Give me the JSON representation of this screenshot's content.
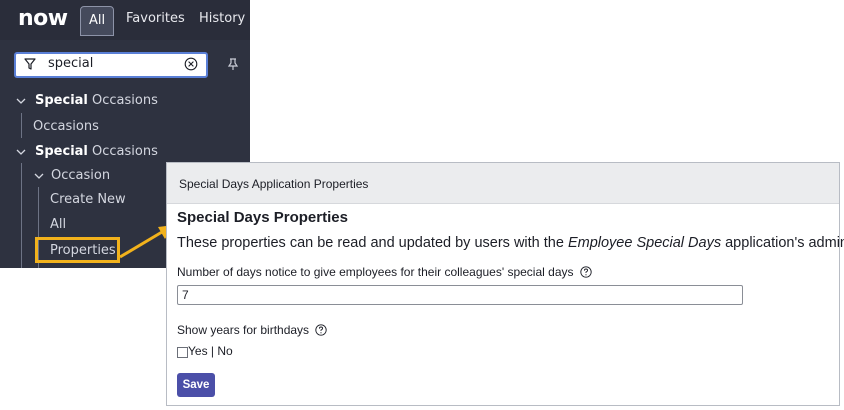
{
  "nav": {
    "logo": "now",
    "tabs": [
      "All",
      "Favorites",
      "History"
    ],
    "filter_value": "special",
    "tree": [
      {
        "bold": "Special",
        "rest": " Occasions"
      },
      {
        "label": "Occasions"
      },
      {
        "bold": "Special",
        "rest": " Occasions"
      },
      {
        "label": "Occasion"
      },
      {
        "label": "Create New"
      },
      {
        "label": "All"
      },
      {
        "label": "Properties"
      }
    ]
  },
  "props": {
    "header": "Special Days Application Properties",
    "title": "Special Days Properties",
    "desc_before": "These properties can be read and updated by users with the ",
    "desc_app": "Employee Special Days",
    "desc_after": " application's admin role.",
    "field1_label": "Number of days notice to give employees for their colleagues' special days",
    "field1_value": "7",
    "field2_label": "Show years for birthdays",
    "field2_options": "Yes | No",
    "save_label": "Save"
  },
  "colors": {
    "nav_bg": "#2e3240",
    "highlight": "#f2b21c",
    "save_button": "#4b4fa8",
    "filter_border": "#5a7fd6"
  }
}
